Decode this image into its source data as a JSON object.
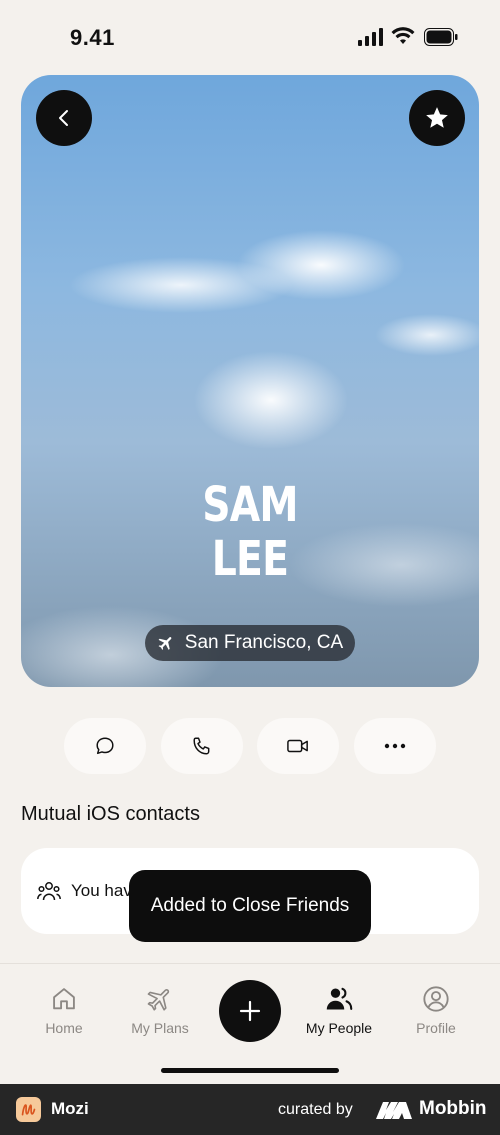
{
  "status_bar": {
    "time": "9.41"
  },
  "profile": {
    "first_name": "SAM",
    "last_name": "LEE",
    "location": "San Francisco, CA"
  },
  "actions": [
    {
      "icon": "chat-bubble-icon"
    },
    {
      "icon": "phone-icon"
    },
    {
      "icon": "video-camera-icon"
    },
    {
      "icon": "more-dots-icon"
    }
  ],
  "mutual": {
    "title": "Mutual iOS contacts",
    "card_text": "You hav"
  },
  "toast": {
    "message": "Added to Close Friends"
  },
  "tabbar": {
    "home": "Home",
    "plans": "My Plans",
    "people": "My People",
    "profile": "Profile"
  },
  "footer": {
    "app_name": "Mozi",
    "curated_by": "curated by",
    "brand": "Mobbin"
  },
  "colors": {
    "background": "#f4f1ed",
    "dark": "#0f0f0f",
    "inactive_tab": "#8c8884",
    "sky": "#8db8e0"
  }
}
